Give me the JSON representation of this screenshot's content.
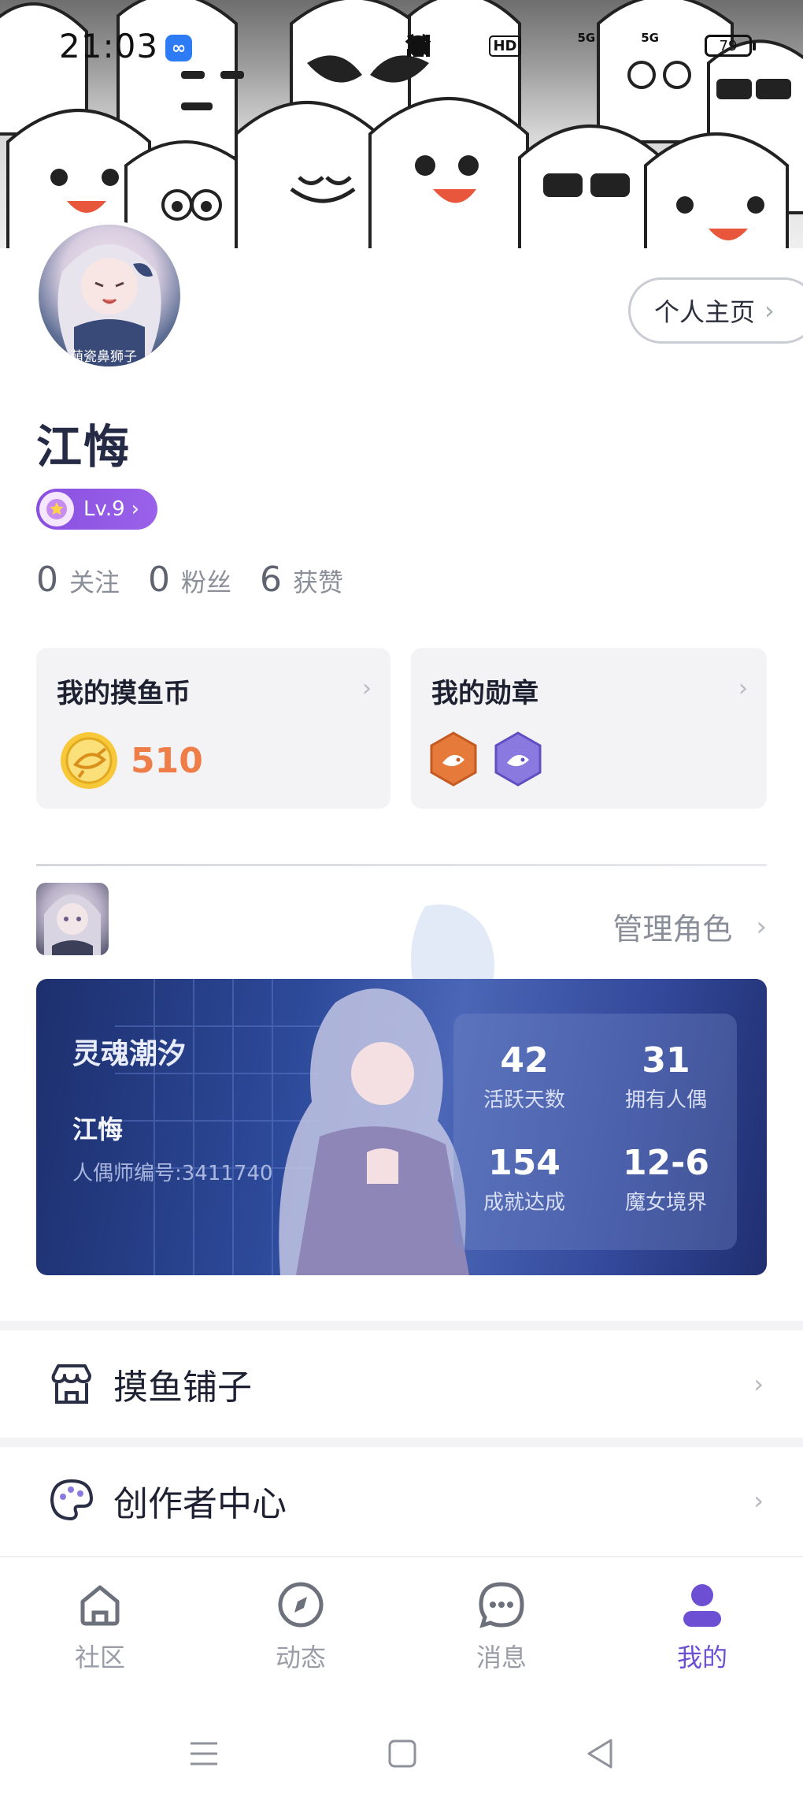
{
  "status_bar": {
    "time": "21:03",
    "app_icon": "infinity-app-icon",
    "network_labels": [
      "5G",
      "5G"
    ],
    "hd_label": "HD",
    "battery": "79"
  },
  "profile": {
    "avatar_caption": "萌瓷鼻狮子",
    "home_button": "个人主页",
    "username": "江悔",
    "level": "Lv.9",
    "stats": [
      {
        "value": "0",
        "label": "关注"
      },
      {
        "value": "0",
        "label": "粉丝"
      },
      {
        "value": "6",
        "label": "获赞"
      }
    ]
  },
  "cards": {
    "coin": {
      "title": "我的摸鱼币",
      "value": "510"
    },
    "medal": {
      "title": "我的勋章",
      "medals": [
        "fish-medal-orange",
        "fish-medal-purple"
      ]
    }
  },
  "character": {
    "manage_label": "管理角色",
    "server": "灵魂潮汐",
    "name": "江悔",
    "id_label": "人偶师编号:3411740",
    "stats": [
      {
        "value": "42",
        "label": "活跃天数"
      },
      {
        "value": "31",
        "label": "拥有人偶"
      },
      {
        "value": "154",
        "label": "成就达成"
      },
      {
        "value": "12-6",
        "label": "魔女境界"
      }
    ]
  },
  "menu": [
    {
      "label": "摸鱼铺子",
      "icon": "shop-icon"
    },
    {
      "label": "创作者中心",
      "icon": "palette-icon"
    }
  ],
  "bottom_nav": [
    {
      "label": "社区",
      "icon": "home-icon",
      "active": false
    },
    {
      "label": "动态",
      "icon": "compass-icon",
      "active": false
    },
    {
      "label": "消息",
      "icon": "chat-icon",
      "active": false
    },
    {
      "label": "我的",
      "icon": "user-icon",
      "active": true
    }
  ],
  "colors": {
    "accent": "#6c4fd3",
    "level_badge": "#8a4fe0",
    "coin_value": "#ef7d48",
    "character_card": "#2d4a9a"
  }
}
